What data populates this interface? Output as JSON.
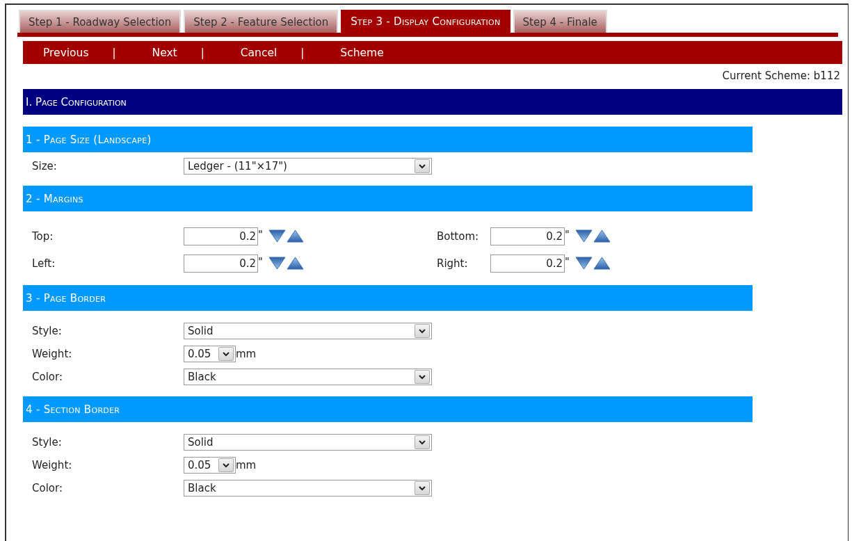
{
  "tabs": [
    {
      "label": "Step 1 - Roadway Selection",
      "selected": false
    },
    {
      "label": "Step 2 - Feature Selection",
      "selected": false
    },
    {
      "label": "Step 3 - Display Configuration",
      "selected": true
    },
    {
      "label": "Step 4 - Finale",
      "selected": false
    }
  ],
  "nav": [
    {
      "kind": "link",
      "label": "Previous"
    },
    {
      "kind": "separator",
      "label": "|"
    },
    {
      "kind": "link",
      "label": "Next"
    },
    {
      "kind": "separator",
      "label": "|"
    },
    {
      "kind": "link",
      "label": "Cancel"
    },
    {
      "kind": "separator",
      "label": "|"
    },
    {
      "kind": "link",
      "label": "Scheme"
    }
  ],
  "current_scheme": "Current Scheme: b112",
  "section": {
    "title": "I. Page Configuration",
    "groups": [
      {
        "title": "1 - Page Size (Landscape)",
        "rows": [
          {
            "kind": "select",
            "label": "Size:",
            "value": "Ledger - (11\"×17\")"
          }
        ]
      },
      {
        "title": "2 - Margins",
        "rows": [
          {
            "kind": "spin_pair",
            "fields": [
              {
                "label": "Top:",
                "value": "0.2",
                "unit": "\""
              },
              {
                "label": "Bottom:",
                "value": "0.2",
                "unit": "\""
              }
            ]
          },
          {
            "kind": "spin_pair",
            "fields": [
              {
                "label": "Left:",
                "value": "0.2",
                "unit": "\""
              },
              {
                "label": "Right:",
                "value": "0.2",
                "unit": "\""
              }
            ]
          }
        ]
      },
      {
        "title": "3 - Page Border",
        "rows": [
          {
            "kind": "select",
            "label": "Style:",
            "value": "Solid"
          },
          {
            "kind": "small_select",
            "label": "Weight:",
            "value": "0.05",
            "unit": "mm"
          },
          {
            "kind": "select",
            "label": "Color:",
            "value": "Black"
          }
        ]
      },
      {
        "title": "4 - Section Border",
        "rows": [
          {
            "kind": "select",
            "label": "Style:",
            "value": "Solid"
          },
          {
            "kind": "small_select",
            "label": "Weight:",
            "value": "0.05",
            "unit": "mm"
          },
          {
            "kind": "select",
            "label": "Color:",
            "value": "Black"
          }
        ]
      }
    ]
  }
}
